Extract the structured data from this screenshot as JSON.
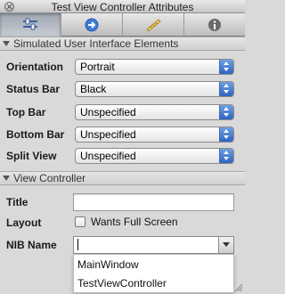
{
  "window": {
    "title": "Test View Controller Attributes"
  },
  "toolbar": {
    "tabs": [
      {
        "icon": "attributes-slider-icon",
        "active": true
      },
      {
        "icon": "connections-arrow-icon",
        "active": false
      },
      {
        "icon": "size-ruler-icon",
        "active": false
      },
      {
        "icon": "identity-info-icon",
        "active": false
      }
    ]
  },
  "simulated": {
    "header": "Simulated User Interface Elements",
    "orientation": {
      "label": "Orientation",
      "value": "Portrait"
    },
    "status_bar": {
      "label": "Status Bar",
      "value": "Black"
    },
    "top_bar": {
      "label": "Top Bar",
      "value": "Unspecified"
    },
    "bottom_bar": {
      "label": "Bottom Bar",
      "value": "Unspecified"
    },
    "split_view": {
      "label": "Split View",
      "value": "Unspecified"
    }
  },
  "view_controller": {
    "header": "View Controller",
    "title": {
      "label": "Title",
      "value": ""
    },
    "layout": {
      "label": "Layout",
      "checkbox_label": "Wants Full Screen",
      "checked": false
    },
    "nib_name": {
      "label": "NIB Name",
      "value": "",
      "options": [
        "MainWindow",
        "TestViewController"
      ]
    }
  },
  "colors": {
    "accent": "#2e63c3",
    "panel": "#d9d9d9"
  }
}
